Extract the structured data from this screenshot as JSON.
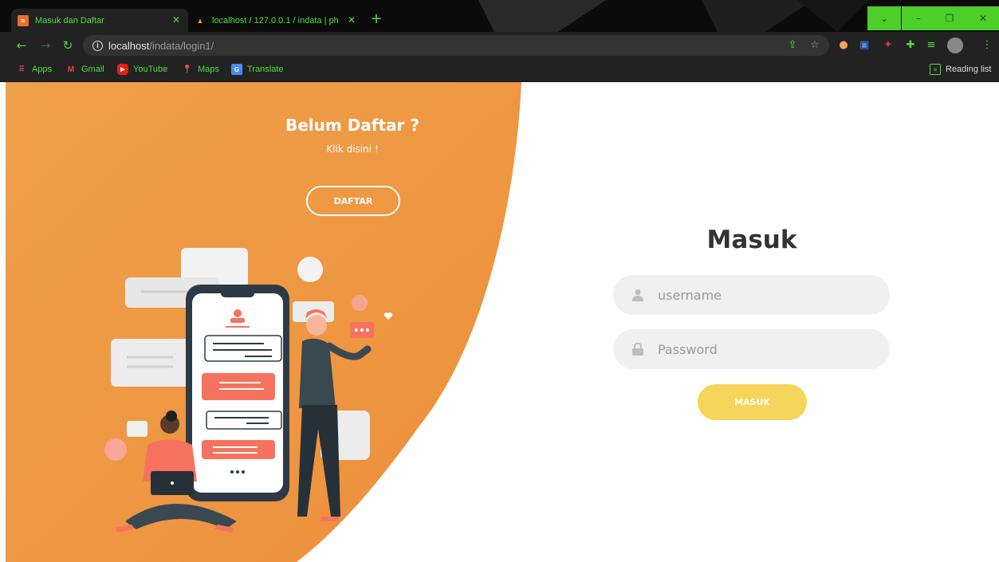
{
  "browser": {
    "tabs": [
      {
        "title": "Masuk dan Daftar",
        "active": true
      },
      {
        "title": "localhost / 127.0.0.1 / indata | ph",
        "active": false
      }
    ],
    "url": {
      "host": "localhost",
      "path": "/indata/login1/"
    },
    "bookmarks": [
      {
        "label": "Apps",
        "icon": "apps-grid-icon"
      },
      {
        "label": "Gmail",
        "icon": "gmail-icon"
      },
      {
        "label": "YouTube",
        "icon": "youtube-icon"
      },
      {
        "label": "Maps",
        "icon": "maps-icon"
      },
      {
        "label": "Translate",
        "icon": "translate-icon"
      }
    ],
    "reading_list": "Reading list",
    "accent_color": "#4ddf3a"
  },
  "signup": {
    "title": "Belum Daftar ?",
    "subtitle": "Klik disini !",
    "button_label": "DAFTAR"
  },
  "login": {
    "title": "Masuk",
    "username_placeholder": "username",
    "password_placeholder": "Password",
    "button_label": "MASUK"
  },
  "colors": {
    "panel_orange": "#ee9a45",
    "button_yellow": "#f5d55a",
    "input_bg": "#f0f0f0",
    "coral": "#f5735e"
  }
}
